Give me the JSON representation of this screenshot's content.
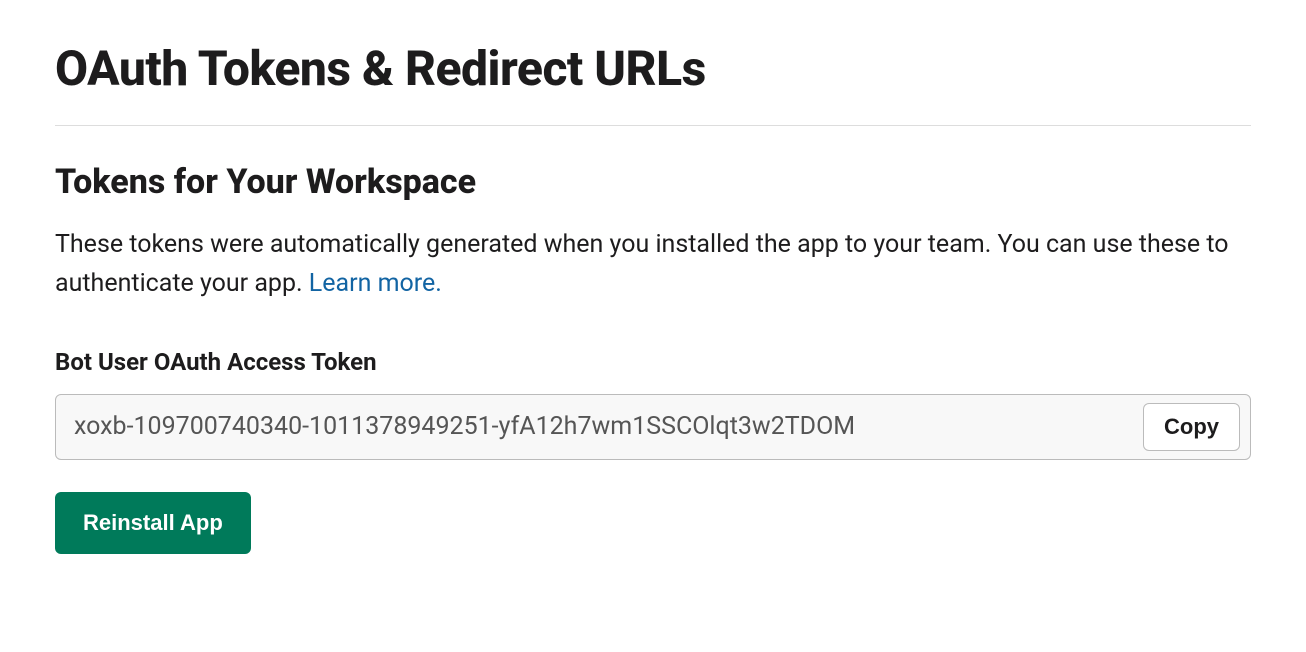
{
  "page": {
    "title": "OAuth Tokens & Redirect URLs"
  },
  "section": {
    "title": "Tokens for Your Workspace",
    "description_pre": "These tokens were automatically generated when you installed the app to your team. You can use these to authenticate your app. ",
    "learn_more": "Learn more."
  },
  "token": {
    "label": "Bot User OAuth Access Token",
    "value": "xoxb-109700740340-1011378949251-yfA12h7wm1SSCOlqt3w2TDOM",
    "copy_label": "Copy"
  },
  "actions": {
    "reinstall_label": "Reinstall App"
  }
}
